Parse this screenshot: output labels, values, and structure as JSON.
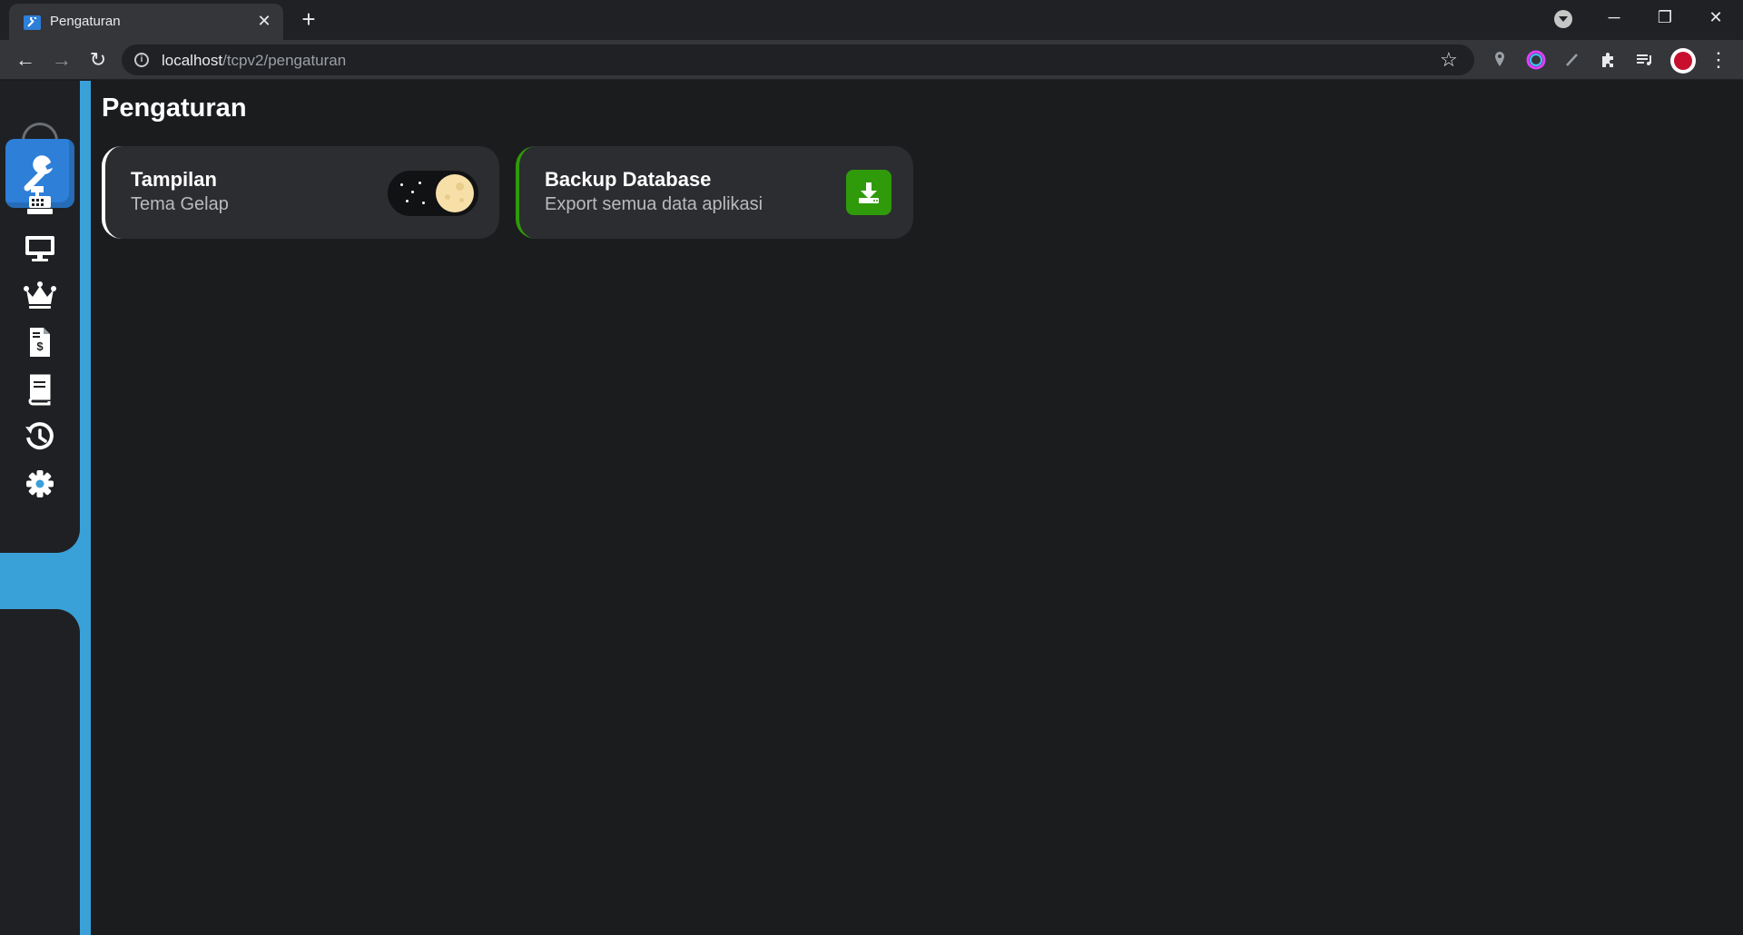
{
  "browser": {
    "tab_title": "Pengaturan",
    "url_host": "localhost",
    "url_path": "/tcpv2/pengaturan"
  },
  "app": {
    "brand_color": "#2d7fd8",
    "accent_color": "#3aa0d8",
    "page_title": "Pengaturan",
    "sidebar": {
      "items": [
        {
          "icon": "cash-register-icon"
        },
        {
          "icon": "monitor-icon"
        },
        {
          "icon": "crown-icon"
        },
        {
          "icon": "invoice-icon"
        },
        {
          "icon": "book-icon"
        },
        {
          "icon": "history-icon"
        },
        {
          "icon": "gear-icon",
          "active": true
        }
      ]
    },
    "cards": {
      "theme": {
        "title": "Tampilan",
        "subtitle": "Tema Gelap",
        "dark_mode": true
      },
      "backup": {
        "title": "Backup Database",
        "subtitle": "Export semua data aplikasi",
        "button_color": "#2f9a0a",
        "icon": "download-icon"
      }
    }
  }
}
